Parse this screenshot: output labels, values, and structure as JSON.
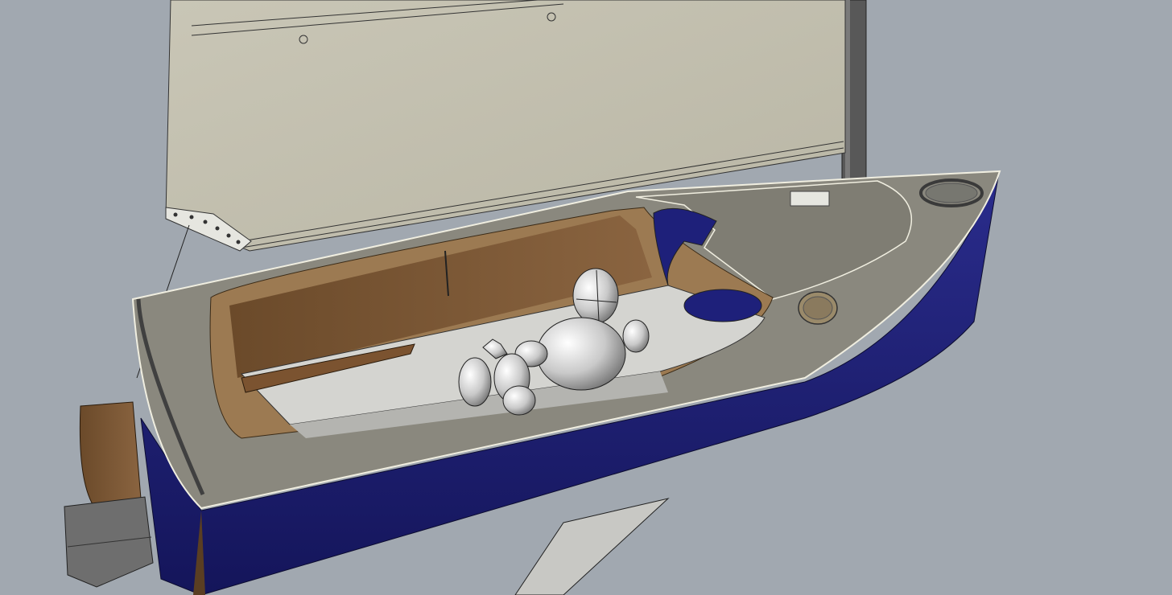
{
  "scene": {
    "subject": "3d-render-sailing-dinghy",
    "colors": {
      "background": "#a1a8b0",
      "sail": "#c2bfae",
      "hull": "#1c1e74",
      "deck": "#8a887e",
      "wood": "#7a5634",
      "cockpit_floor": "#d2d2d2",
      "mast": "#555555",
      "figure": "#d8d8d8",
      "outline": "#1a1a1a"
    }
  }
}
